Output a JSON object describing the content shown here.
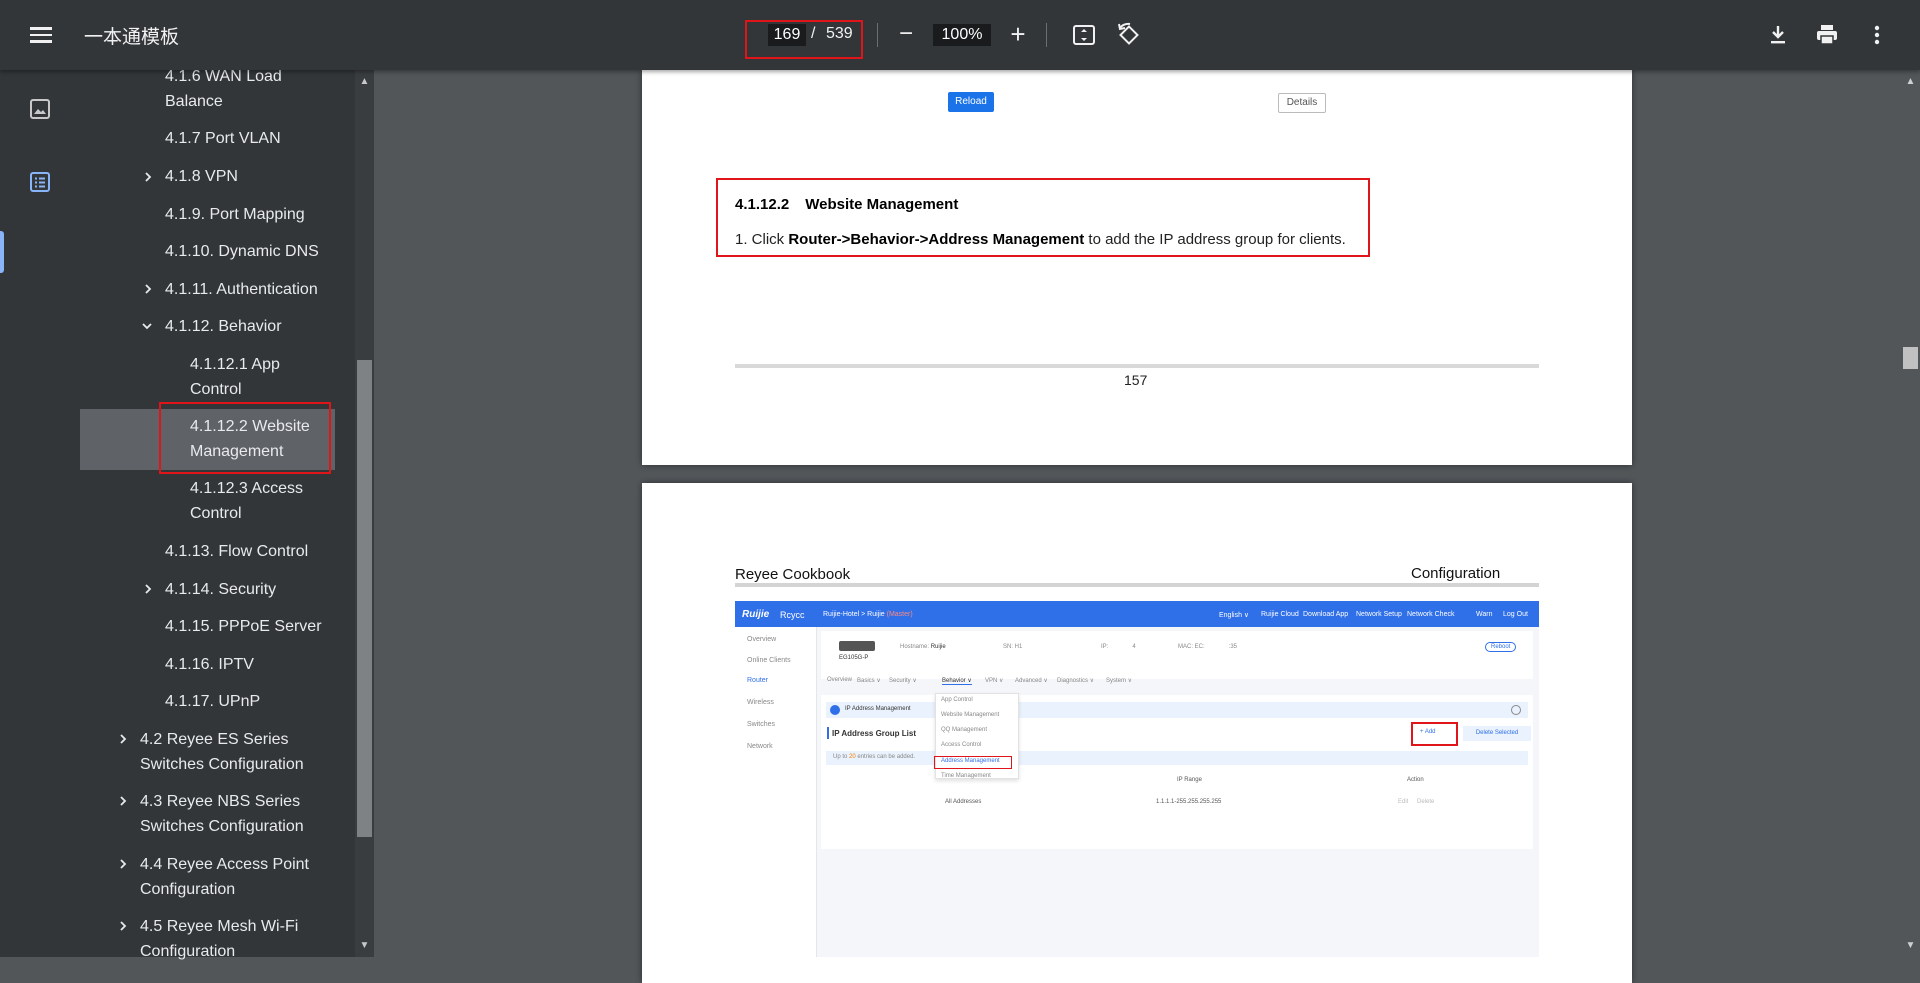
{
  "toolbar": {
    "title": "一本通模板",
    "current_page": "169",
    "separator": "/",
    "total_pages": "539",
    "zoom": "100%"
  },
  "outline": {
    "items": [
      {
        "label": "4.1.6 WAN Load",
        "label2": "Balance",
        "expandable": false
      },
      {
        "label": "4.1.7 Port VLAN",
        "expandable": false
      },
      {
        "label": "4.1.8 VPN",
        "expandable": true
      },
      {
        "label": "4.1.9. Port Mapping",
        "expandable": false
      },
      {
        "label": "4.1.10. Dynamic DNS",
        "expandable": false
      },
      {
        "label": "4.1.11. Authentication",
        "expandable": true
      },
      {
        "label": "4.1.12. Behavior",
        "expandable": true,
        "expanded": true
      },
      {
        "label": "4.1.12.1 App",
        "label2": "Control",
        "expandable": false
      },
      {
        "label": "4.1.12.2 Website",
        "label2": "Management",
        "expandable": false,
        "selected": true
      },
      {
        "label": "4.1.12.3 Access",
        "label2": "Control",
        "expandable": false
      },
      {
        "label": "4.1.13. Flow Control",
        "expandable": false
      },
      {
        "label": "4.1.14. Security",
        "expandable": true
      },
      {
        "label": "4.1.15. PPPoE Server",
        "expandable": false
      },
      {
        "label": "4.1.16. IPTV",
        "expandable": false
      },
      {
        "label": "4.1.17. UPnP",
        "expandable": false
      },
      {
        "label": "4.2 Reyee ES Series",
        "label2": "Switches Configuration",
        "expandable": true
      },
      {
        "label": "4.3 Reyee NBS Series",
        "label2": "Switches Configuration",
        "expandable": true
      },
      {
        "label": "4.4 Reyee Access Point",
        "label2": "Configuration",
        "expandable": true
      },
      {
        "label": "4.5 Reyee Mesh Wi-Fi",
        "label2": "Configuration",
        "expandable": true
      }
    ]
  },
  "page1": {
    "reload": "Reload",
    "details": "Details",
    "section_number": "4.1.12.2",
    "section_title": "Website Management",
    "step_prefix": "1. Click ",
    "step_bold": "Router->Behavior->Address Management",
    "step_suffix": " to add the IP address group for clients.",
    "page_number": "157"
  },
  "page2": {
    "header_left": "Reyee Cookbook",
    "header_right": "Configuration"
  },
  "shot": {
    "brand": "Ruijie",
    "brand2": "Rcycc",
    "crumb": "Ruijie-Hotel > Ruijie",
    "crumb_tag": "(Master)",
    "top_links": [
      "English ∨",
      "Ruijie Cloud",
      "Download App",
      "Network Setup",
      "Network Check",
      "Warn",
      "Log Out"
    ],
    "side_items": [
      "Overview",
      "Online Clients",
      "Router",
      "Wireless",
      "Switches",
      "Network"
    ],
    "device": "EG105G-P",
    "hostname_label": "Hostname:",
    "hostname": "Ruijie",
    "sn_label": "SN: H1",
    "ip_label": "IP:",
    "ip_tail": "4",
    "mac_label": "MAC: EC:",
    "mac_tail": ":35",
    "reboot": "Reboot",
    "tabs": [
      "Overview",
      "Basics ∨",
      "Security ∨",
      "Behavior ∨",
      "VPN ∨",
      "Advanced ∨",
      "Diagnostics ∨",
      "System ∨"
    ],
    "menu_items": [
      "App Control",
      "Website Management",
      "QQ Management",
      "Access Control",
      "Address Management",
      "Time Management"
    ],
    "panel_title": "IP Address Management",
    "list_title": "IP Address Group List",
    "add": "+ Add",
    "delete_selected": "Delete Selected",
    "info_prefix": "Up to",
    "info_count": "20",
    "info_suffix": "entries can be added.",
    "col_range": "IP Range",
    "col_action": "Action",
    "row_name": "All Addresses",
    "row_range": "1.1.1.1-255.255.255.255",
    "row_edit": "Edit",
    "row_delete": "Delete"
  }
}
